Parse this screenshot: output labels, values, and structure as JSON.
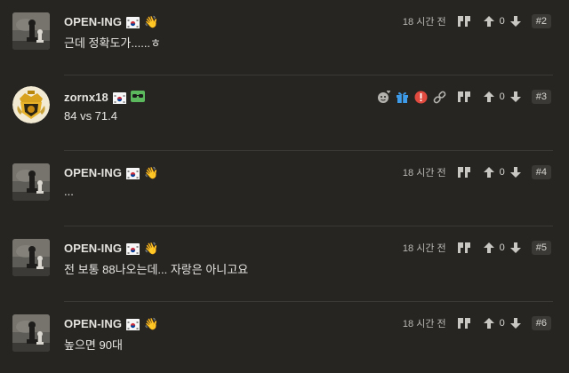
{
  "posts": [
    {
      "username": "OPEN-ING",
      "badge_icon": "waving-hand-icon",
      "badge_glyph": "👋",
      "text": "근데 정확도가......ㅎ",
      "timestamp": "18 시간 전",
      "votes": "0",
      "number": "#2",
      "avatar": "chess-pieces"
    },
    {
      "username": "zornx18",
      "badge_icon": "sunglasses-badge-icon",
      "badge_glyph": "",
      "text": "84 vs 71.4",
      "timestamp": "",
      "votes": "0",
      "number": "#3",
      "avatar": "crest"
    },
    {
      "username": "OPEN-ING",
      "badge_icon": "waving-hand-icon",
      "badge_glyph": "👋",
      "text": "...",
      "timestamp": "18 시간 전",
      "votes": "0",
      "number": "#4",
      "avatar": "chess-pieces"
    },
    {
      "username": "OPEN-ING",
      "badge_icon": "waving-hand-icon",
      "badge_glyph": "👋",
      "text": "전 보통 88나오는데... 자랑은 아니고요",
      "timestamp": "18 시간 전",
      "votes": "0",
      "number": "#5",
      "avatar": "chess-pieces"
    },
    {
      "username": "OPEN-ING",
      "badge_icon": "waving-hand-icon",
      "badge_glyph": "👋",
      "text": "높으면 90대",
      "timestamp": "18 시간 전",
      "votes": "0",
      "number": "#6",
      "avatar": "chess-pieces"
    }
  ],
  "colors": {
    "background": "#262522",
    "divider": "#3a3935",
    "badge_green": "#5cb85c",
    "gift_blue": "#3d9be9",
    "alert_red": "#e04a3f"
  }
}
